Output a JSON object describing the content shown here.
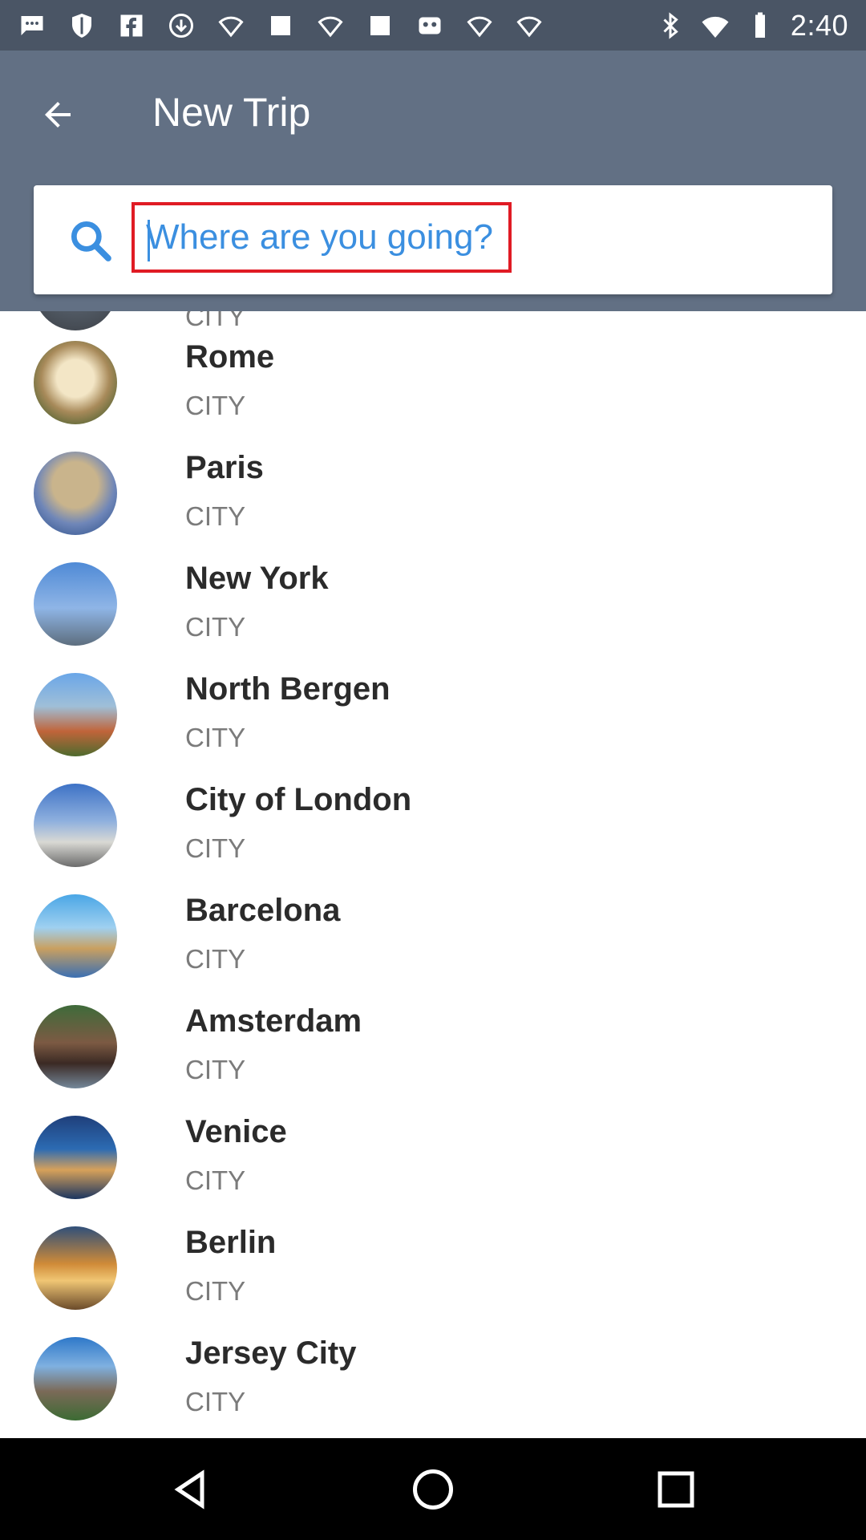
{
  "status_bar": {
    "time": "2:40",
    "icons": [
      "chat-icon",
      "shield-icon",
      "facebook-icon",
      "download-icon",
      "wifi-icon",
      "square-icon",
      "wifi-icon",
      "square-icon",
      "robot-icon",
      "wifi-icon",
      "wifi-icon",
      "bluetooth-icon",
      "wifi-signal-icon",
      "battery-icon"
    ]
  },
  "toolbar": {
    "title": "New Trip",
    "back_icon": "arrow-back-icon"
  },
  "search": {
    "placeholder": "Where are you going?",
    "icon": "search-icon"
  },
  "list": {
    "partial_label": "CITY",
    "items": [
      {
        "name": "Rome",
        "type": "CITY"
      },
      {
        "name": "Paris",
        "type": "CITY"
      },
      {
        "name": "New York",
        "type": "CITY"
      },
      {
        "name": "North Bergen",
        "type": "CITY"
      },
      {
        "name": "City of London",
        "type": "CITY"
      },
      {
        "name": "Barcelona",
        "type": "CITY"
      },
      {
        "name": "Amsterdam",
        "type": "CITY"
      },
      {
        "name": "Venice",
        "type": "CITY"
      },
      {
        "name": "Berlin",
        "type": "CITY"
      },
      {
        "name": "Jersey City",
        "type": "CITY"
      }
    ]
  },
  "nav_bar": {
    "back": "nav-back-icon",
    "home": "nav-home-icon",
    "recents": "nav-recents-icon"
  },
  "colors": {
    "status_bar": "#4a5565",
    "toolbar": "#627084",
    "highlight_border": "#e01b24",
    "placeholder": "#3b8fe0"
  }
}
